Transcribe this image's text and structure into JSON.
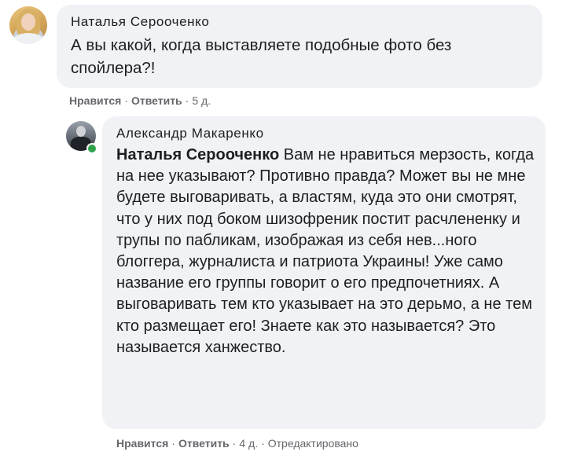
{
  "comments": [
    {
      "author": "Наталья Серооченко",
      "text": "А вы какой, когда выставляете подобные фото без спойлера?!",
      "actions": {
        "like": "Нравится",
        "reply": "Ответить",
        "time": "5 д."
      }
    },
    {
      "author": "Александр Макаренко",
      "mention": "Наталья Серооченко",
      "text": "Вам не нравиться мерзость, когда на нее указывают? Противно правда? Может вы не мне будете выговаривать, а властям, куда это они смотрят, что у них под боком шизофреник постит расчлененку и трупы по пабликам, изображая из себя нев...ного блоггера, журналиста и патриота Украины! Уже само название его группы говорит о его предпочетниях. А выговаривать тем кто указывает на это дерьмо, а не тем кто размещает его! Знаете как это называется? Это называется ханжество.",
      "actions": {
        "like": "Нравится",
        "reply": "Ответить",
        "time": "4 д.",
        "edited": "Отредактировано"
      }
    }
  ],
  "colors": {
    "bubble": "#f0f2f5",
    "meta": "#65676b",
    "online": "#31a24c"
  }
}
